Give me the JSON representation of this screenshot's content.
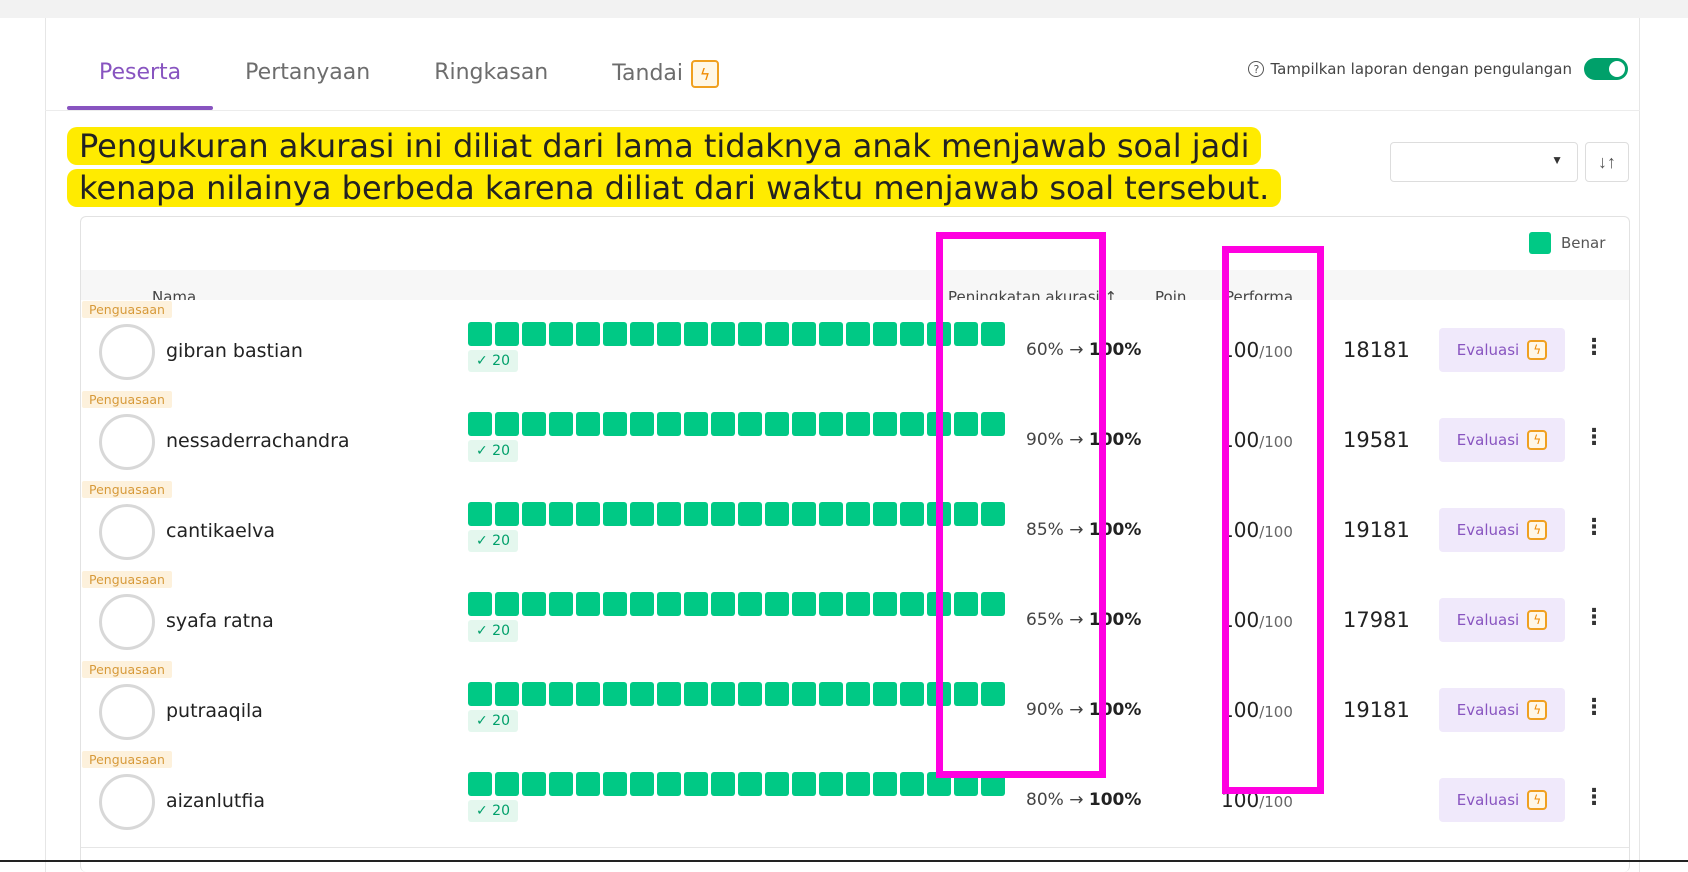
{
  "tabs": [
    {
      "label": "Peserta",
      "active": true
    },
    {
      "label": "Pertanyaan",
      "active": false
    },
    {
      "label": "Ringkasan",
      "active": false
    },
    {
      "label": "Tandai",
      "active": false
    }
  ],
  "flag_glyph": "ϟ",
  "toggle": {
    "label": "Tampilkan laporan dengan pengulangan",
    "on": true,
    "color": "#00a06a"
  },
  "help_glyph": "?",
  "sort_glyph": "↓↑",
  "caption": "Pengukuran akurasi ini diliat dari lama tidaknya anak menjawab soal jadi kenapa nilainya berbeda karena diliat dari waktu menjawab soal tersebut.",
  "legend": {
    "label": "Benar",
    "color": "#00c985"
  },
  "headers": {
    "name": "Nama",
    "accuracy": "Peningkatan akurasi ↑",
    "points": "Poin",
    "performance": "Performa"
  },
  "rows": [
    {
      "badge": "Penguasaan",
      "name": "gibran bastian",
      "correct": "✓ 20",
      "acc_from": "60%",
      "arrow": "→",
      "acc_to": "100%",
      "points": "100",
      "points_max": "/100",
      "performance": "18181",
      "eval": "Evaluasi",
      "more": "⋮",
      "avatar_color": "#e9584d",
      "avatar_icon": "avatar-icon"
    },
    {
      "badge": "Penguasaan",
      "name": "nessaderrachandra",
      "correct": "✓ 20",
      "acc_from": "90%",
      "arrow": "→",
      "acc_to": "100%",
      "points": "100",
      "points_max": "/100",
      "performance": "19581",
      "eval": "Evaluasi",
      "more": "⋮",
      "avatar_color": "#f1b942",
      "avatar_icon": "avatar-icon"
    },
    {
      "badge": "Penguasaan",
      "name": "cantikaelva",
      "correct": "✓ 20",
      "acc_from": "85%",
      "arrow": "→",
      "acc_to": "100%",
      "points": "100",
      "points_max": "/100",
      "performance": "19181",
      "eval": "Evaluasi",
      "more": "⋮",
      "avatar_color": "#e94b3c",
      "avatar_icon": "avatar-icon"
    },
    {
      "badge": "Penguasaan",
      "name": "syafa ratna",
      "correct": "✓ 20",
      "acc_from": "65%",
      "arrow": "→",
      "acc_to": "100%",
      "points": "100",
      "points_max": "/100",
      "performance": "17981",
      "eval": "Evaluasi",
      "more": "⋮",
      "avatar_color": "#3fb8c2",
      "avatar_icon": "avatar-icon"
    },
    {
      "badge": "Penguasaan",
      "name": "putraaqila",
      "correct": "✓ 20",
      "acc_from": "90%",
      "arrow": "→",
      "acc_to": "100%",
      "points": "100",
      "points_max": "/100",
      "performance": "19181",
      "eval": "Evaluasi",
      "more": "⋮",
      "avatar_color": "#4fb7c9",
      "avatar_icon": "avatar-icon"
    },
    {
      "badge": "Penguasaan",
      "name": "aizanlutfia",
      "correct": "✓ 20",
      "acc_from": "80%",
      "arrow": "→",
      "acc_to": "100%",
      "points": "100",
      "points_max": "/100",
      "performance": "",
      "eval": "Evaluasi",
      "more": "⋮",
      "avatar_color": "#d84a3e",
      "avatar_icon": "avatar-icon"
    }
  ],
  "colors": {
    "accent": "#8854c0",
    "correct": "#00c985",
    "highlight": "#ff00e0",
    "caption_bg": "#ffeb00"
  }
}
